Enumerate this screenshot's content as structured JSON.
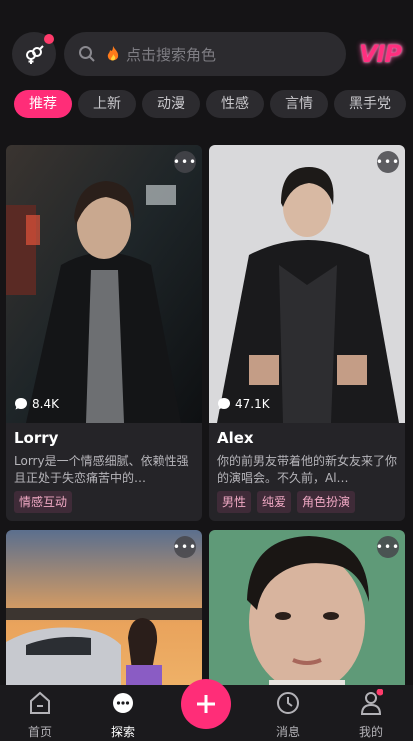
{
  "header": {
    "search_placeholder": "点击搜索角色",
    "vip_label": "VIP",
    "gender_icon": "gender-icon"
  },
  "tabs": [
    "推荐",
    "上新",
    "动漫",
    "性感",
    "言情",
    "黑手党"
  ],
  "active_tab": 0,
  "cards": [
    {
      "likes": "8.4K",
      "name": "Lorry",
      "description": "Lorry是一个情感细腻、依赖性强且正处于失恋痛苦中的…",
      "tags": [
        "情感互动"
      ]
    },
    {
      "likes": "47.1K",
      "name": "Alex",
      "description": "你的前男友带着他的新女友来了你的演唱会。不久前，Al…",
      "tags": [
        "男性",
        "纯爱",
        "角色扮演"
      ]
    }
  ],
  "bottom_nav": {
    "home": "首页",
    "explore": "探索",
    "messages": "消息",
    "mine": "我的"
  },
  "colors": {
    "accent": "#ff2d78",
    "background": "#151416",
    "card": "#252428"
  }
}
